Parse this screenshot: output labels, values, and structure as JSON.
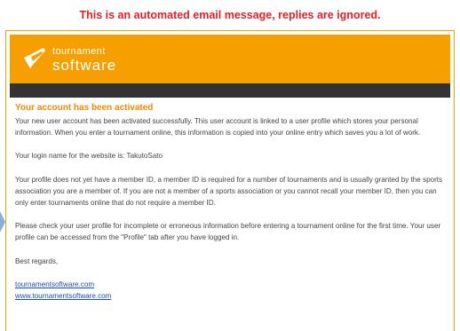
{
  "notice": "This is an automated email message, replies are ignored.",
  "brand": {
    "line1": "tournament",
    "line2": "software",
    "colors": {
      "orange": "#f5a000",
      "dark_bar": "#333333",
      "notice_red": "#e21f26",
      "heading_orange": "#f08a00",
      "link_blue": "#1a4db8"
    }
  },
  "email": {
    "heading": "Your account has been activated",
    "paragraphs": [
      "Your new user account has been activated successfully. This user account is linked to a user profile which stores your personal information. When you enter a tournament online, this information is copied into your online entry which saves you a lot of work.",
      "Your login name for the website is: TakutoSato",
      "Your profile does not yet have a member ID, a member ID is required for a number of tournaments and is usually granted by the sports association you are a member of. If you are not a member of a sports association or you cannot recall your member ID, then you can only enter tournaments online that do not require a member ID.",
      "Please check your user profile for incomplete or erroneous information before entering a tournament online for the first time. Your user profile can be accessed from the \"Profile\" tab after you have logged in.",
      "Best regards,"
    ],
    "links": [
      "tournamentsoftware.com",
      "www.tournamentsoftware.com"
    ]
  }
}
